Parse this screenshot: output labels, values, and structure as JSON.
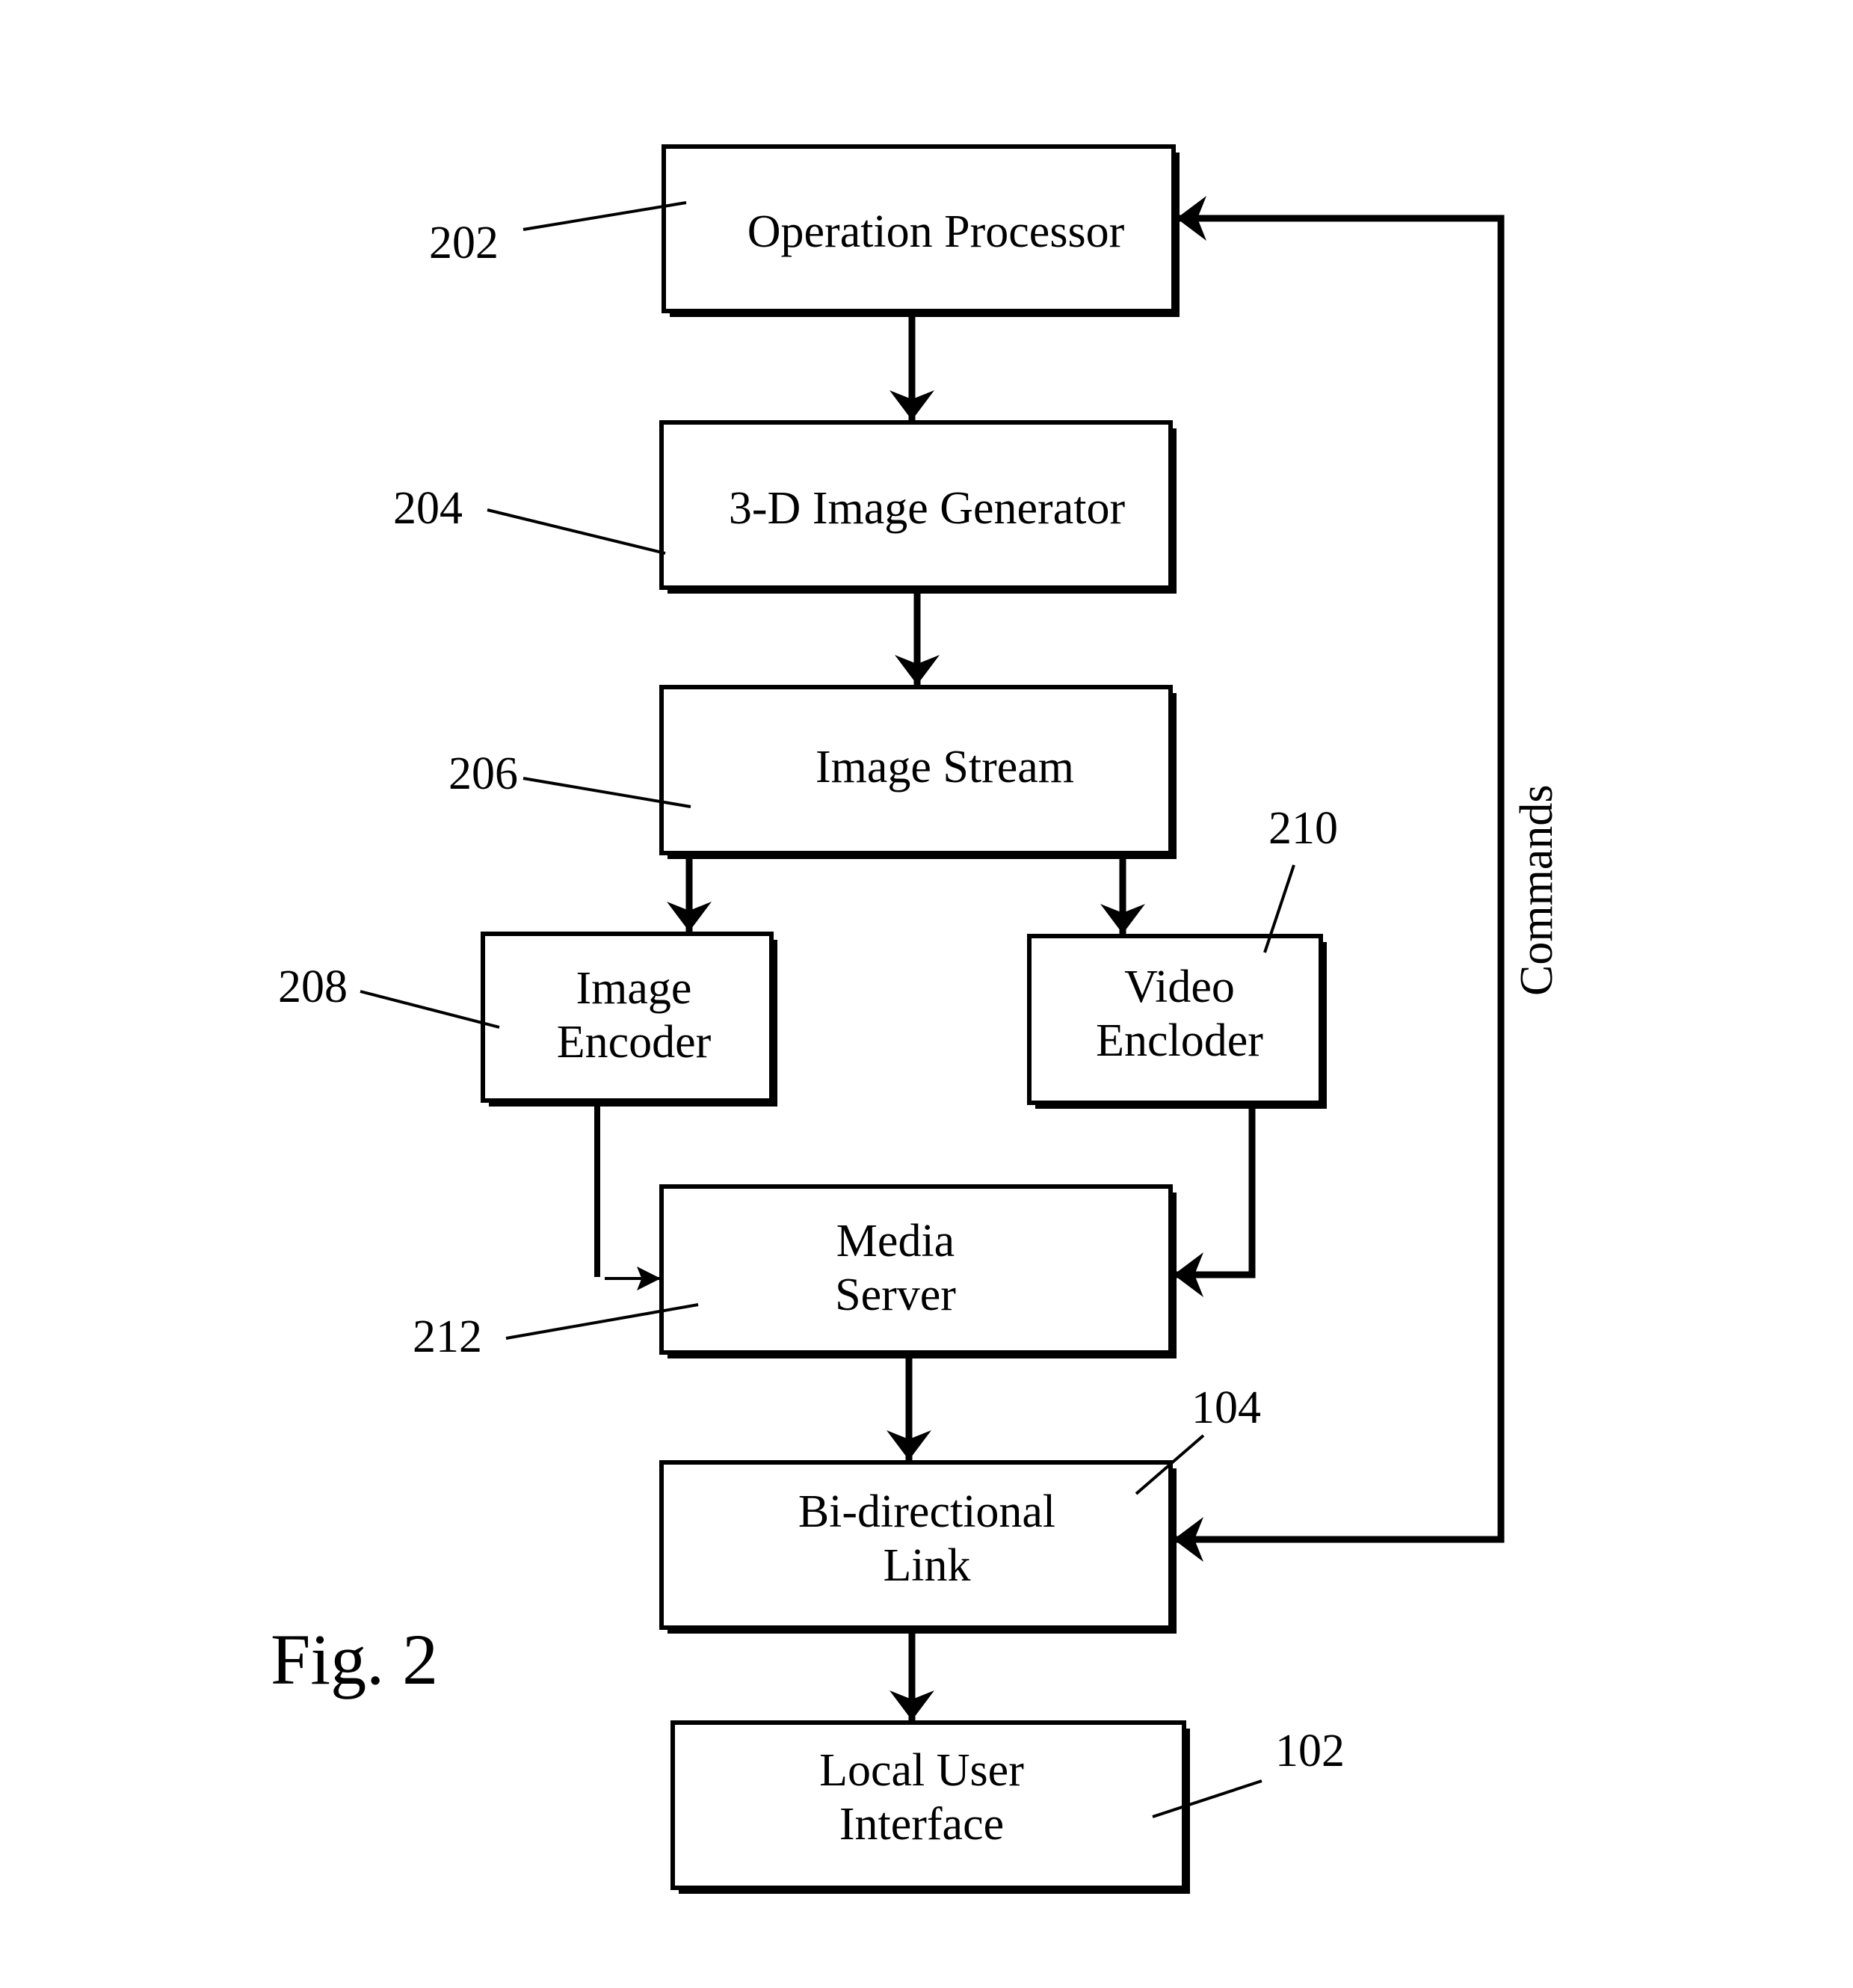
{
  "figure": {
    "caption": "Fig. 2",
    "colors": {
      "ink": "#000000",
      "background": "#ffffff"
    }
  },
  "blocks": [
    {
      "id": "operation_processor",
      "ref": "202",
      "lines": [
        "Operation Processor"
      ]
    },
    {
      "id": "image_generator_3d",
      "ref": "204",
      "lines": [
        "3-D Image Generator"
      ]
    },
    {
      "id": "image_stream",
      "ref": "206",
      "lines": [
        "Image Stream"
      ]
    },
    {
      "id": "image_encoder",
      "ref": "208",
      "lines": [
        "Image",
        "Encoder"
      ]
    },
    {
      "id": "video_encoder",
      "ref": "210",
      "lines": [
        "Video",
        "Encloder"
      ]
    },
    {
      "id": "media_server",
      "ref": "212",
      "lines": [
        "Media",
        "Server"
      ]
    },
    {
      "id": "bidirectional_link",
      "ref": "104",
      "lines": [
        "Bi-directional",
        "Link"
      ]
    },
    {
      "id": "local_user_interface",
      "ref": "102",
      "lines": [
        "Local User",
        "Interface"
      ]
    }
  ],
  "connections": [
    {
      "from": "operation_processor",
      "to": "image_generator_3d"
    },
    {
      "from": "image_generator_3d",
      "to": "image_stream"
    },
    {
      "from": "image_stream",
      "to": "image_encoder"
    },
    {
      "from": "image_stream",
      "to": "video_encoder"
    },
    {
      "from": "image_encoder",
      "to": "media_server"
    },
    {
      "from": "video_encoder",
      "to": "media_server"
    },
    {
      "from": "media_server",
      "to": "bidirectional_link"
    },
    {
      "from": "bidirectional_link",
      "to": "local_user_interface"
    },
    {
      "from": "bidirectional_link",
      "to": "operation_processor",
      "label": "Commands"
    }
  ],
  "labels": {
    "commands": "Commands"
  }
}
